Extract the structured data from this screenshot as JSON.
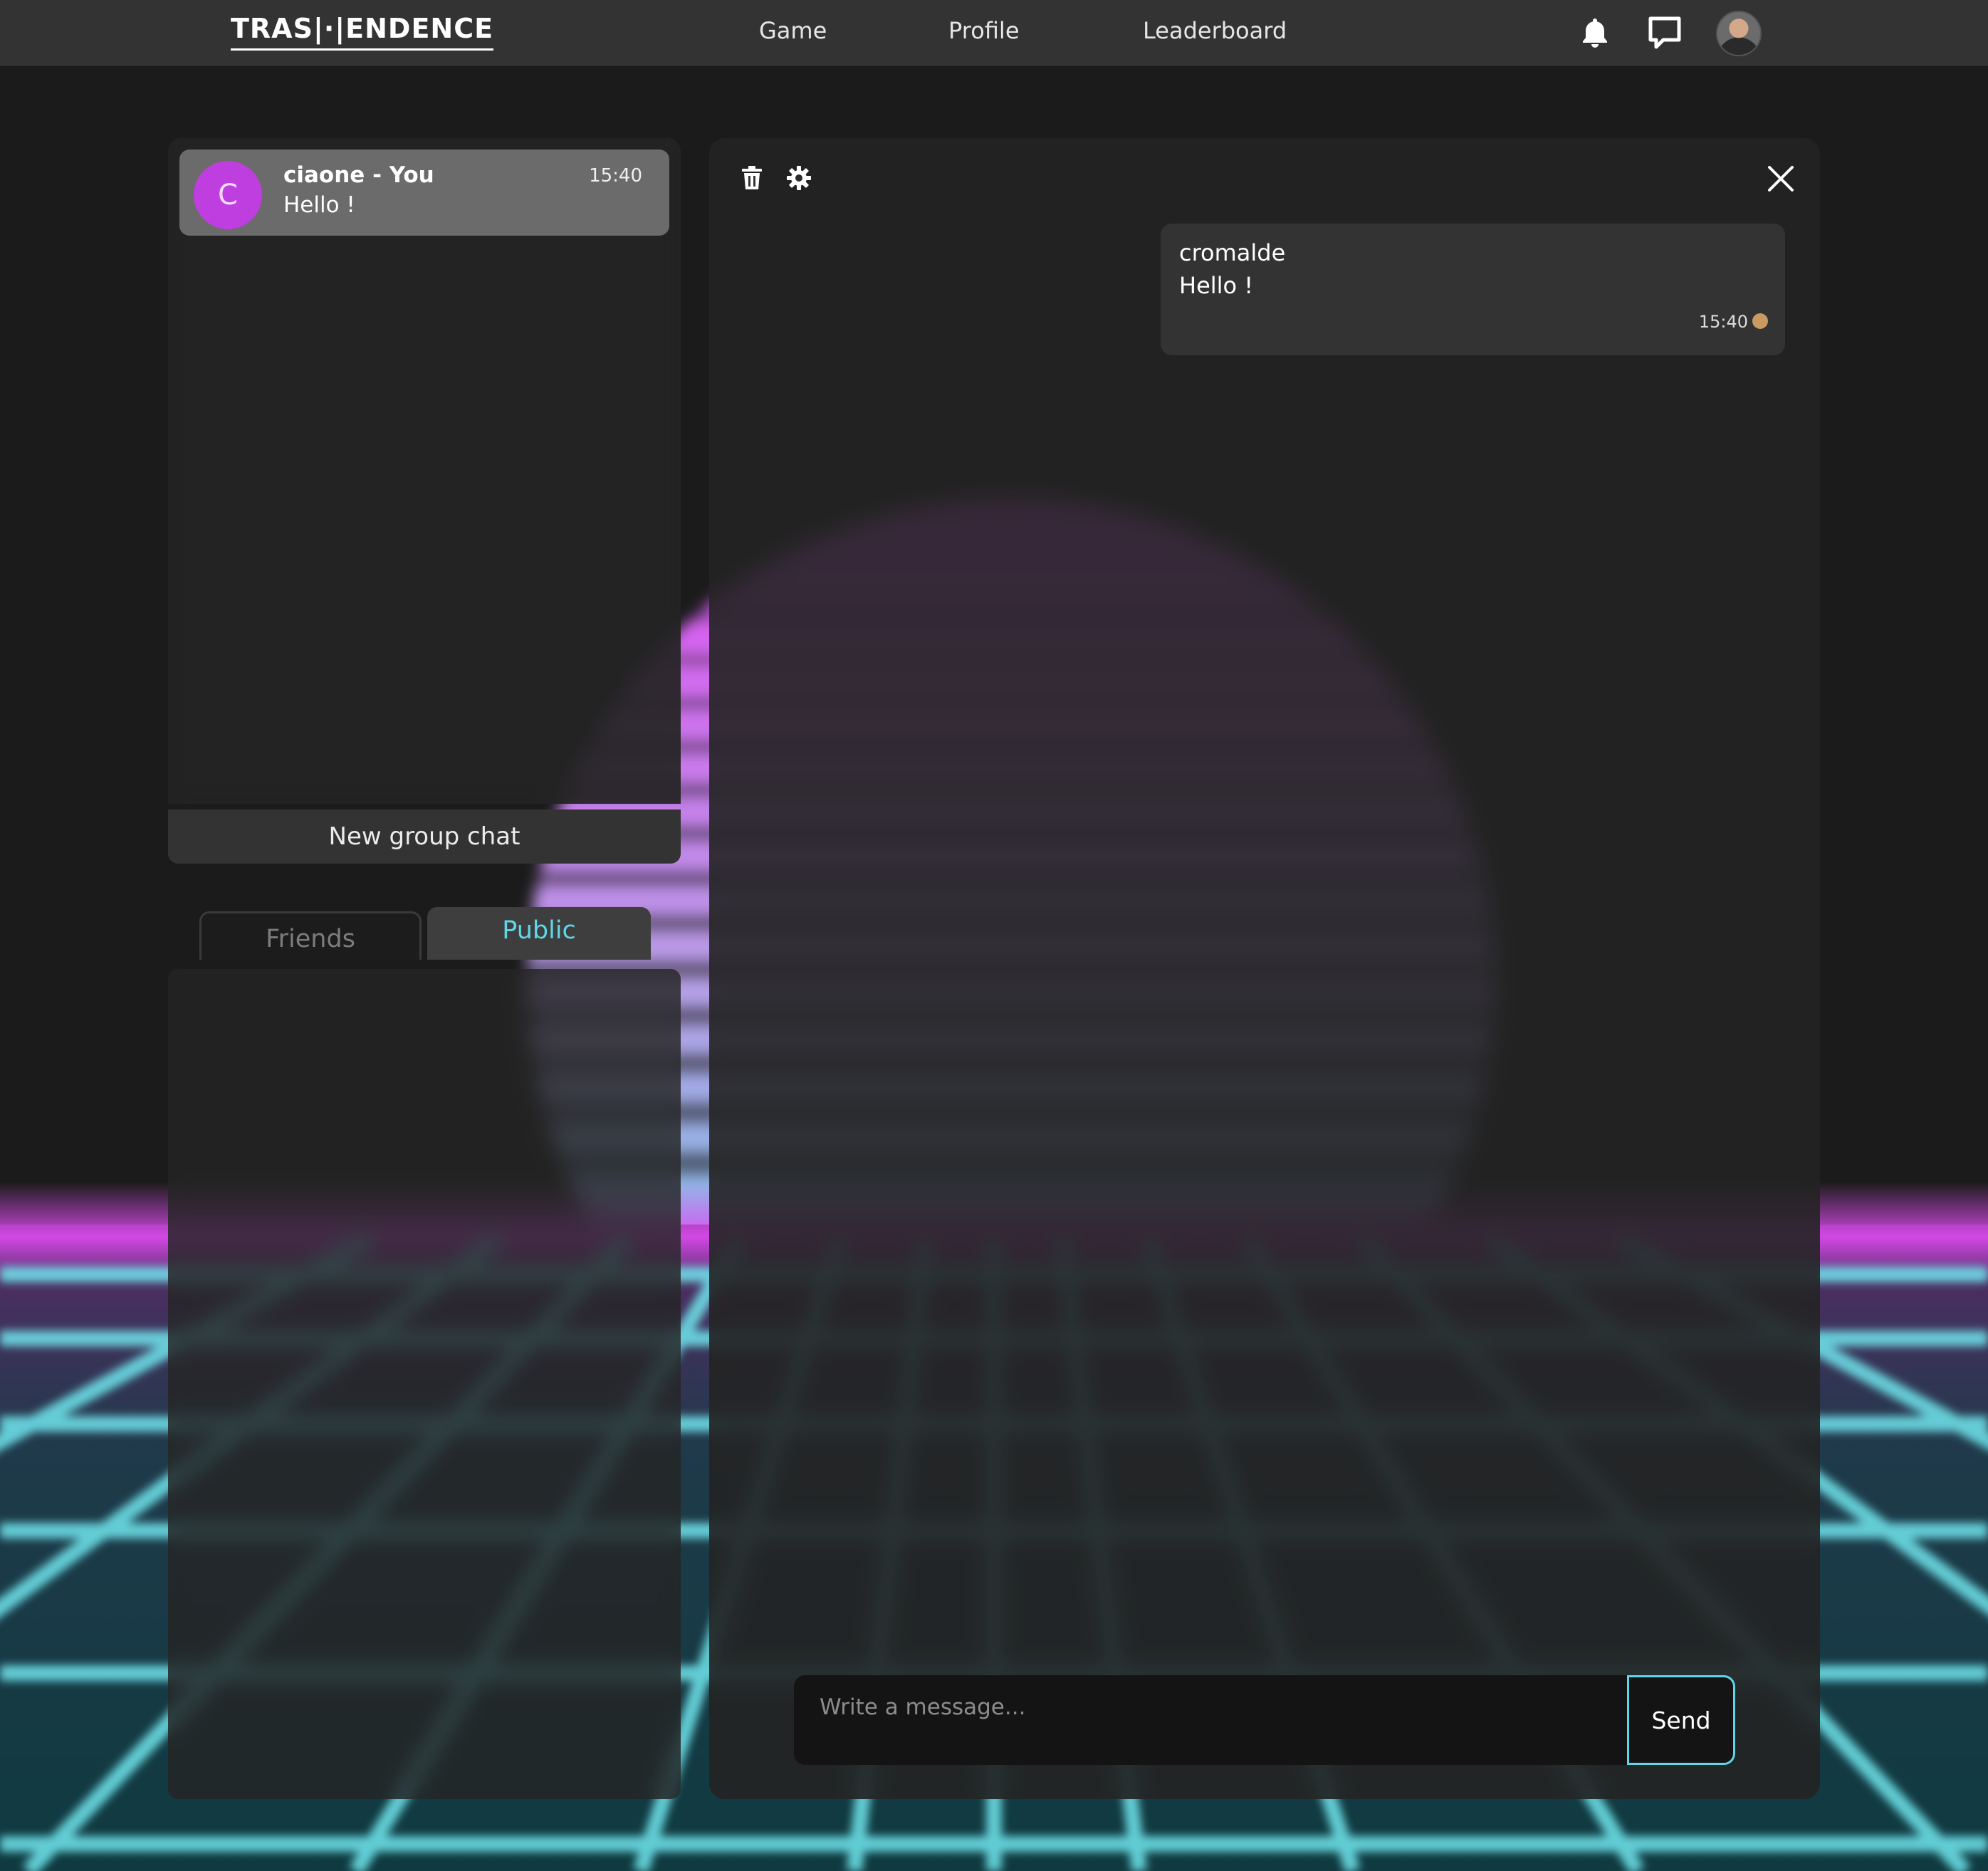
{
  "navbar": {
    "logo": "TRAS|·|ENDENCE",
    "links": [
      "Game",
      "Profile",
      "Leaderboard"
    ],
    "icons": [
      "bell-icon",
      "chat-bubble-icon",
      "user-avatar"
    ]
  },
  "conversations": [
    {
      "initial": "C",
      "name": "ciaone - You",
      "preview": "Hello !",
      "time": "15:40",
      "avatar_color": "#bf3ee0"
    }
  ],
  "new_group_label": "New group chat",
  "tabs": {
    "friends": "Friends",
    "public": "Public",
    "active": "Public"
  },
  "chat": {
    "toolbar_icons": [
      "trash-icon",
      "gear-icon",
      "close-icon"
    ],
    "messages": [
      {
        "sender": "cromalde",
        "text": "Hello !",
        "time": "15:40"
      }
    ],
    "input_placeholder": "Write a message...",
    "send_label": "Send"
  },
  "colors": {
    "accent_cyan": "#5fd7e8",
    "accent_magenta": "#d94fe8",
    "panel_bg": "#242424",
    "navbar_bg": "#333333"
  }
}
